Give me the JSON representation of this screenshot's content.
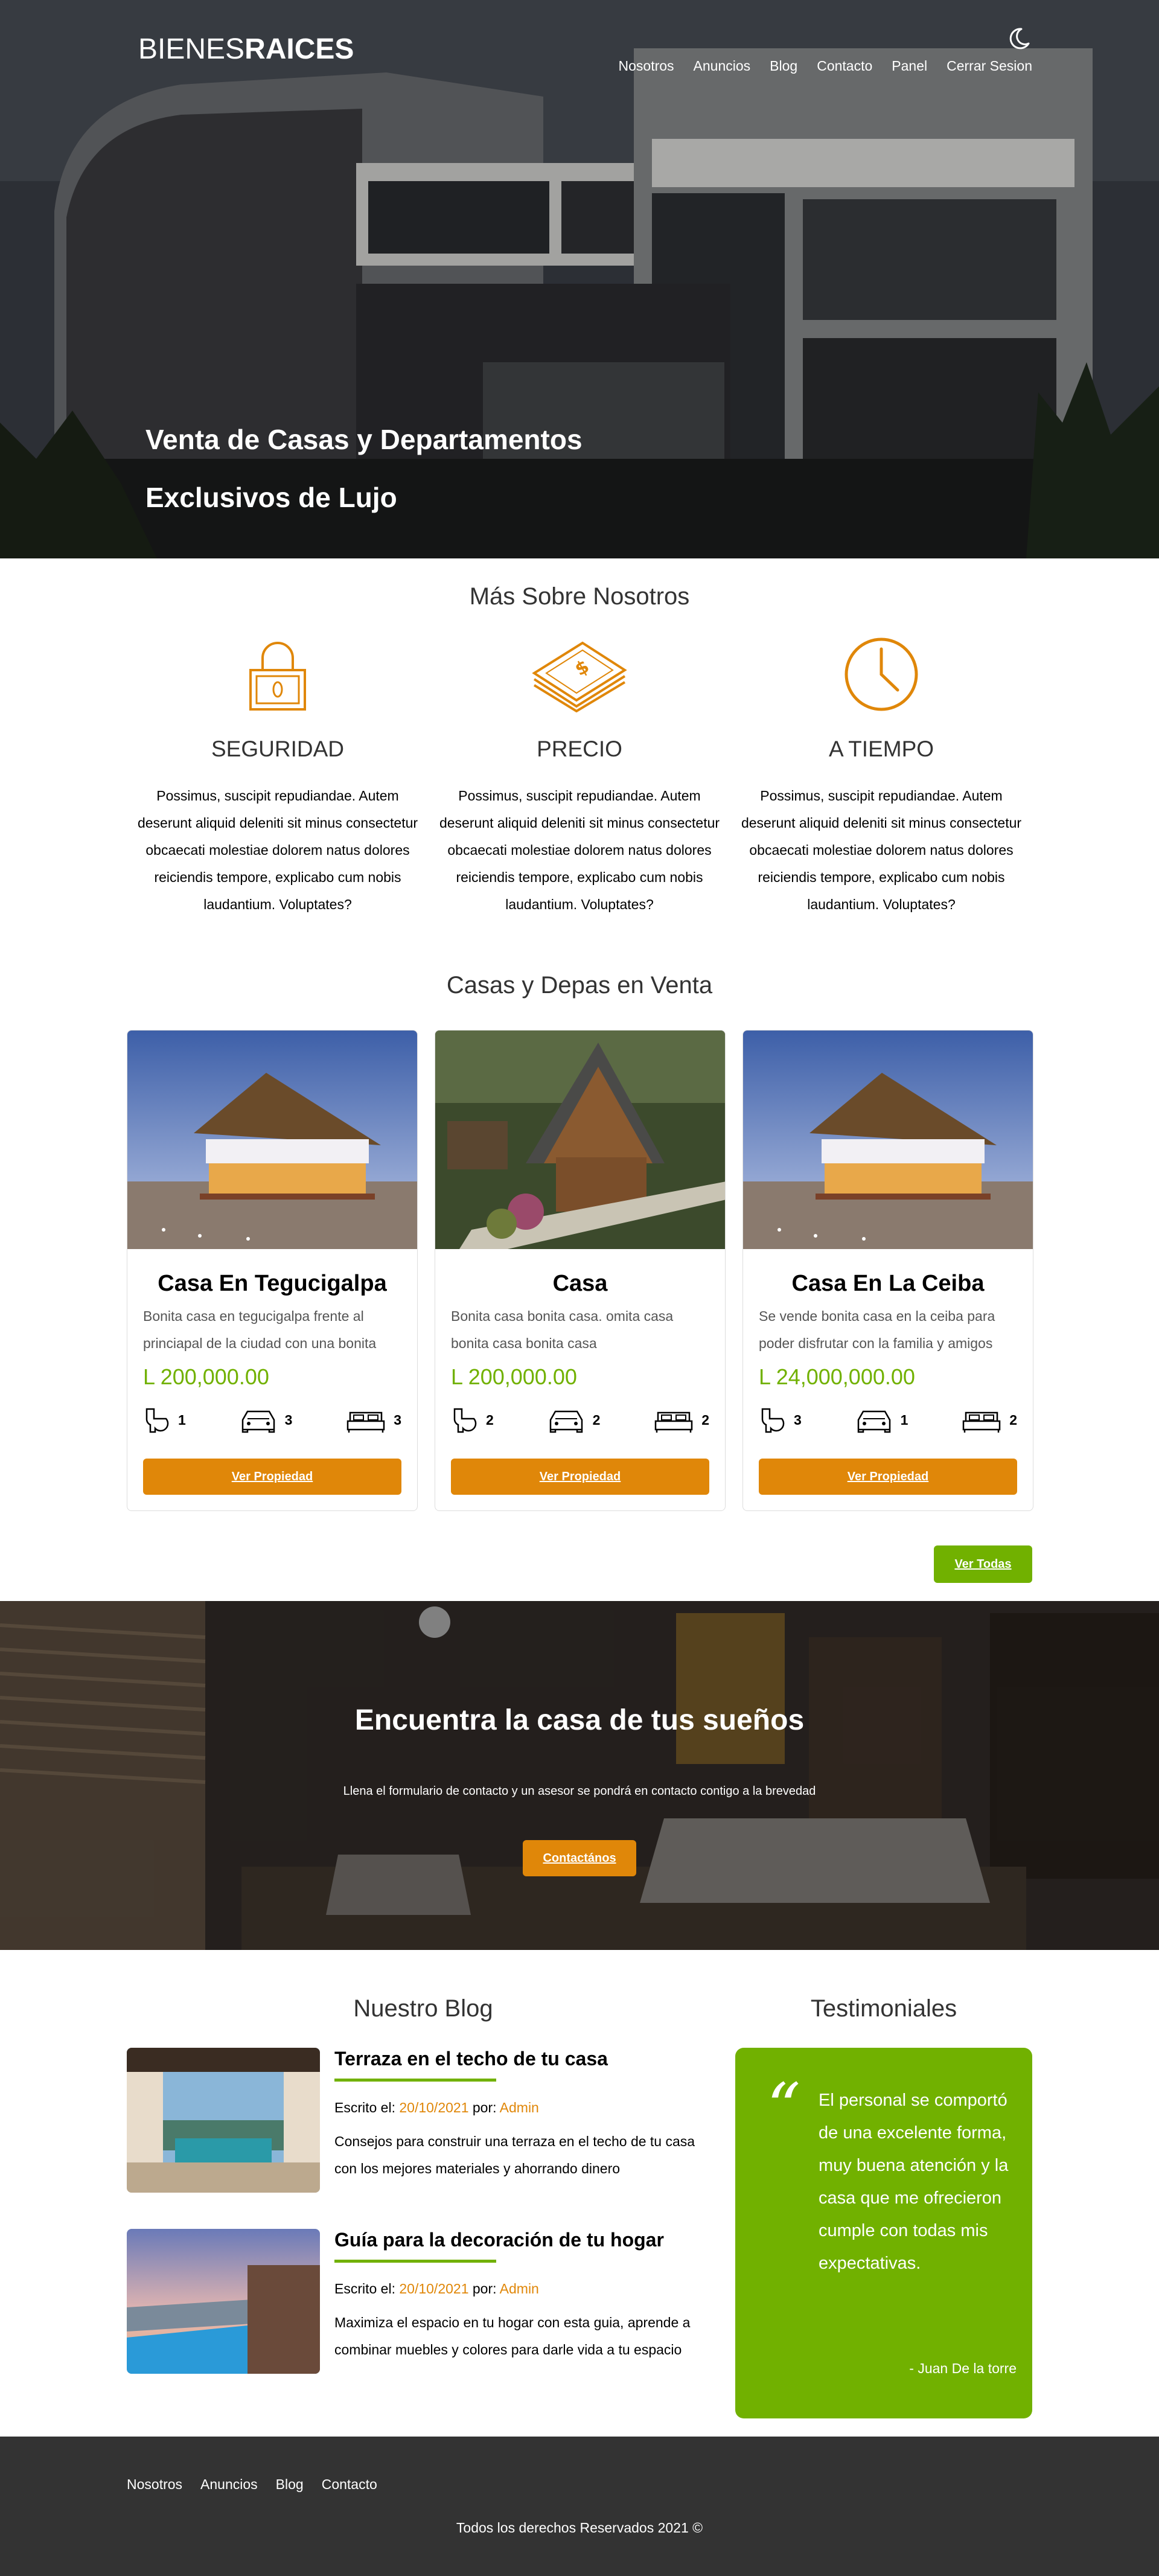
{
  "header": {
    "logo_light": "BIENES",
    "logo_bold": "RAICES",
    "nav": [
      "Nosotros",
      "Anuncios",
      "Blog",
      "Contacto",
      "Panel",
      "Cerrar Sesion"
    ],
    "hero_line1": "Venta de Casas y Departamentos",
    "hero_line2": "Exclusivos de Lujo"
  },
  "nosotros": {
    "title": "Más Sobre Nosotros",
    "items": [
      {
        "icon": "lock-icon",
        "title": "SEGURIDAD",
        "text": "Possimus, suscipit repudiandae. Autem deserunt aliquid deleniti sit minus consectetur obcaecati molestiae dolorem natus dolores reiciendis tempore, explicabo cum nobis laudantium. Voluptates?"
      },
      {
        "icon": "money-icon",
        "title": "PRECIO",
        "text": "Possimus, suscipit repudiandae. Autem deserunt aliquid deleniti sit minus consectetur obcaecati molestiae dolorem natus dolores reiciendis tempore, explicabo cum nobis laudantium. Voluptates?"
      },
      {
        "icon": "clock-icon",
        "title": "A TIEMPO",
        "text": "Possimus, suscipit repudiandae. Autem deserunt aliquid deleniti sit minus consectetur obcaecati molestiae dolorem natus dolores reiciendis tempore, explicabo cum nobis laudantium. Voluptates?"
      }
    ]
  },
  "casas": {
    "title": "Casas y Depas en Venta",
    "cards": [
      {
        "title": "Casa En Tegucigalpa",
        "desc": "Bonita casa en tegucigalpa frente al princiapal de la ciudad con una bonita",
        "price": "L 200,000.00",
        "wc": "1",
        "estacionamiento": "3",
        "habitaciones": "3",
        "button": "Ver Propiedad"
      },
      {
        "title": "Casa",
        "desc": "Bonita casa bonita casa. omita casa bonita casa bonita casa",
        "price": "L 200,000.00",
        "wc": "2",
        "estacionamiento": "2",
        "habitaciones": "2",
        "button": "Ver Propiedad"
      },
      {
        "title": "Casa En La Ceiba",
        "desc": "Se vende bonita casa en la ceiba para poder disfrutar con la familia y amigos",
        "price": "L 24,000,000.00",
        "wc": "3",
        "estacionamiento": "1",
        "habitaciones": "2",
        "button": "Ver Propiedad"
      }
    ],
    "ver_todas": "Ver Todas"
  },
  "cta": {
    "title": "Encuentra la casa de tus sueños",
    "text": "Llena el formulario de contacto y un asesor se pondrá en contacto contigo a la brevedad",
    "button": "Contactános"
  },
  "blog": {
    "title": "Nuestro Blog",
    "entries": [
      {
        "title": "Terraza en el techo de tu casa",
        "escrito": "Escrito el:",
        "fecha": "20/10/2021",
        "por": "por:",
        "autor": "Admin",
        "text": "Consejos para construir una terraza en el techo de tu casa con los mejores materiales y ahorrando dinero"
      },
      {
        "title": "Guía para la decoración de tu hogar",
        "escrito": "Escrito el:",
        "fecha": "20/10/2021",
        "por": "por:",
        "autor": "Admin",
        "text": "Maximiza el espacio en tu hogar con esta guia, aprende a combinar muebles y colores para darle vida a tu espacio"
      }
    ]
  },
  "testimoniales": {
    "title": "Testimoniales",
    "quote_mark": "“",
    "text": "El personal se comportó de una excelente forma, muy buena atención y la casa que me ofrecieron cumple con todas mis expectativas.",
    "author": "- Juan De la torre"
  },
  "footer": {
    "nav": [
      "Nosotros",
      "Anuncios",
      "Blog",
      "Contacto"
    ],
    "copyright": "Todos los derechos Reservados 2021 ©"
  },
  "colors": {
    "accent": "#e08709",
    "green": "#71b100",
    "footer": "#333333"
  }
}
